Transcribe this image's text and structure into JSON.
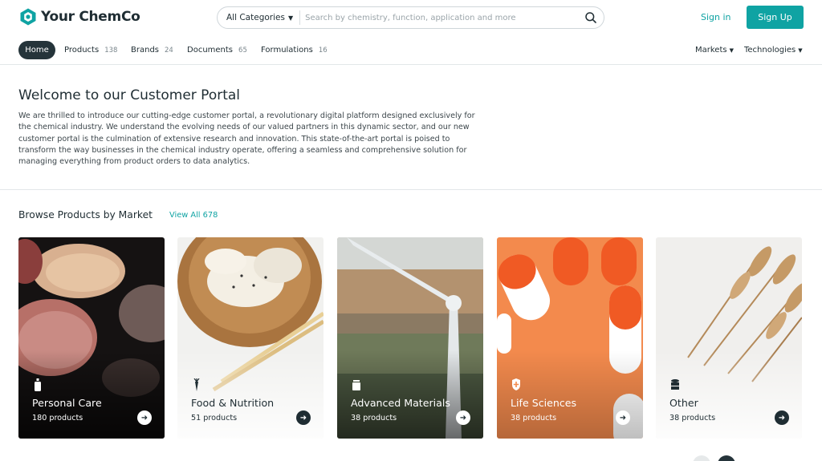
{
  "brand": {
    "name": "Your ChemCo",
    "accent": "#0fa3a3",
    "dark": "#25343a"
  },
  "search": {
    "category": "All Categories",
    "placeholder": "Search by chemistry, function, application and more"
  },
  "auth": {
    "signin": "Sign in",
    "signup": "Sign Up"
  },
  "nav": {
    "home": "Home",
    "items": [
      {
        "label": "Products",
        "count": "138"
      },
      {
        "label": "Brands",
        "count": "24"
      },
      {
        "label": "Documents",
        "count": "65"
      },
      {
        "label": "Formulations",
        "count": "16"
      }
    ],
    "right": [
      {
        "label": "Markets"
      },
      {
        "label": "Technologies"
      }
    ]
  },
  "welcome": {
    "title": "Welcome to our Customer Portal",
    "body": "We are thrilled to introduce our cutting-edge customer portal, a revolutionary digital platform designed exclusively for the chemical industry. We understand the evolving needs of our valued partners in this dynamic sector, and our new customer portal is the culmination of extensive research and innovation. This state-of-the-art portal is poised to transform the way businesses in the chemical industry operate, offering a seamless and comprehensive solution for managing everything from product orders to data analytics."
  },
  "browse": {
    "title": "Browse Products by Market",
    "view_all": "View All 678"
  },
  "markets": [
    {
      "name": "Personal Care",
      "count": "180 products",
      "icon": "bottle-icon"
    },
    {
      "name": "Food & Nutrition",
      "count": "51 products",
      "icon": "carrot-icon"
    },
    {
      "name": "Advanced Materials",
      "count": "38 products",
      "icon": "container-icon"
    },
    {
      "name": "Life Sciences",
      "count": "38 products",
      "icon": "shield-plus-icon"
    },
    {
      "name": "Other",
      "count": "38 products",
      "icon": "database-icon"
    }
  ]
}
